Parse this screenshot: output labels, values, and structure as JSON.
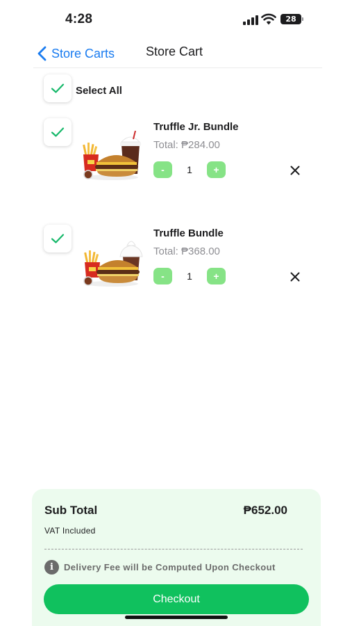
{
  "status_bar": {
    "time": "4:28",
    "battery_level": "28",
    "icons": [
      "cellular-signal-icon",
      "wifi-icon",
      "battery-icon"
    ]
  },
  "nav": {
    "back_label": "Store Carts",
    "title": "Store Cart",
    "accent_color": "#1a7cf0"
  },
  "select_all": {
    "label": "Select All",
    "checked": true
  },
  "items": [
    {
      "name": "Truffle Jr. Bundle",
      "total": "Total: ₱284.00",
      "quantity": "1",
      "checked": true,
      "image": "burger-meal-with-fries-and-soda"
    },
    {
      "name": "Truffle Bundle",
      "total": "Total: ₱368.00",
      "quantity": "1",
      "checked": true,
      "image": "burger-meal-with-fries-and-float"
    }
  ],
  "qty_controls": {
    "minus_label": "-",
    "plus_label": "+",
    "color": "#86e386"
  },
  "summary": {
    "subtotal_label": "Sub Total",
    "subtotal_value": "₱652.00",
    "vat_label": "VAT Included",
    "delivery_note": "Delivery Fee will be Computed Upon Checkout",
    "checkout_label": "Checkout",
    "panel_color": "#ecfbee",
    "button_color": "#10c15e",
    "check_color": "#16b86a"
  }
}
